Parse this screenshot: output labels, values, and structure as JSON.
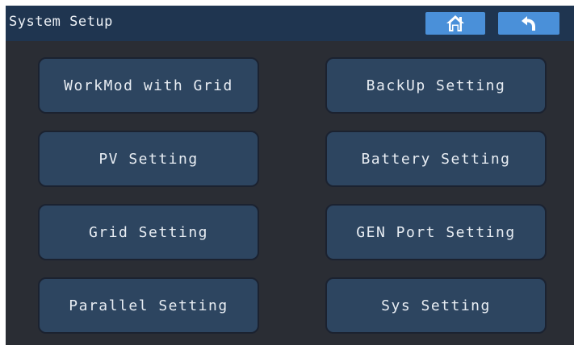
{
  "header": {
    "title": "System Setup",
    "home_icon": "home-icon",
    "back_icon": "back-arrow-icon"
  },
  "menu": {
    "left": [
      {
        "label": "WorkMod with Grid"
      },
      {
        "label": "PV Setting"
      },
      {
        "label": "Grid Setting"
      },
      {
        "label": "Parallel Setting"
      }
    ],
    "right": [
      {
        "label": "BackUp Setting"
      },
      {
        "label": "Battery Setting"
      },
      {
        "label": "GEN Port Setting"
      },
      {
        "label": "Sys Setting"
      }
    ]
  },
  "colors": {
    "background": "#2a2d34",
    "header": "#1f3550",
    "button": "#2d4560",
    "accent": "#4a90d9",
    "text": "#e8edf3"
  }
}
